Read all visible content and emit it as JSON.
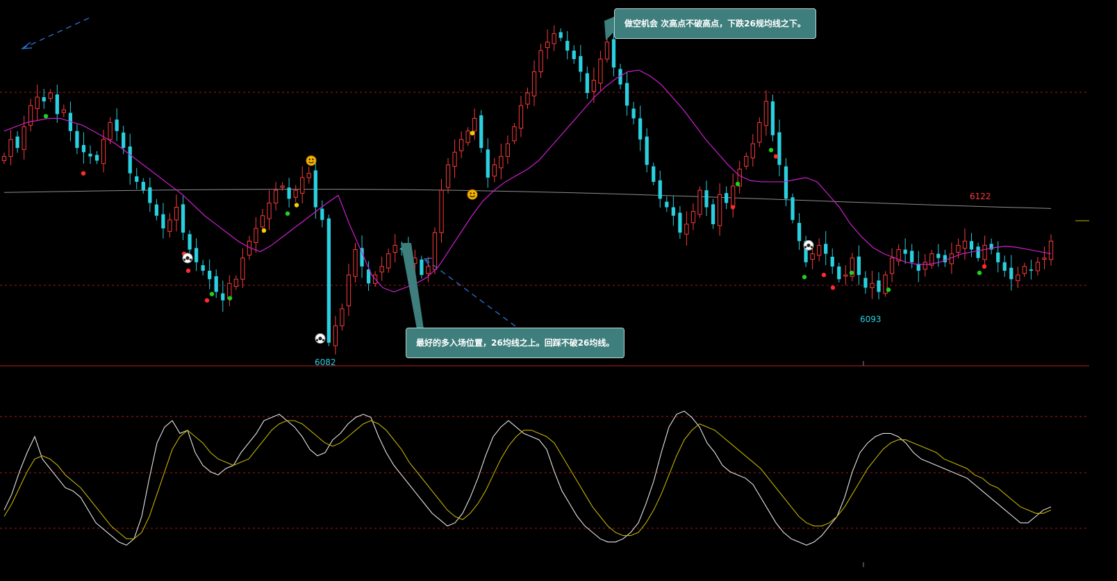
{
  "chart_data": [
    {
      "type": "candlestick",
      "title": "",
      "ma_labels": [],
      "price_labels": [
        {
          "text": "6082",
          "value": 6082,
          "color": "#2ad0e0"
        },
        {
          "text": "6093",
          "value": 6093,
          "color": "#2ad0e0"
        },
        {
          "text": "6122",
          "value": 6122,
          "color": "#ff3b3b"
        }
      ],
      "annotations": [
        {
          "text": "做空机会 次高点不破高点，下跌26规均线之下。"
        },
        {
          "text": "最好的多入场位置，26均线之上。回踩不破26均线。"
        }
      ],
      "ylim": [
        6079,
        6160
      ],
      "close": [
        6126,
        6130,
        6128,
        6133,
        6138,
        6140,
        6139,
        6141,
        6136,
        6137,
        6132,
        6128,
        6127,
        6126,
        6125,
        6130,
        6134,
        6132,
        6128,
        6122,
        6120,
        6118,
        6115,
        6112,
        6109,
        6111,
        6114,
        6108,
        6104,
        6101,
        6099,
        6097,
        6094,
        6092,
        6096,
        6097,
        6102,
        6106,
        6109,
        6112,
        6115,
        6118,
        6119,
        6116,
        6118,
        6121,
        6122,
        6114,
        6111,
        6082,
        6086,
        6090,
        6098,
        6104,
        6100,
        6096,
        6098,
        6100,
        6103,
        6105,
        6104,
        6100,
        6102,
        6098,
        6100,
        6108,
        6118,
        6124,
        6127,
        6130,
        6132,
        6135,
        6128,
        6121,
        6124,
        6126,
        6129,
        6133,
        6138,
        6141,
        6146,
        6151,
        6153,
        6155,
        6154,
        6151,
        6149,
        6146,
        6141,
        6144,
        6149,
        6153,
        6147,
        6143,
        6138,
        6135,
        6130,
        6124,
        6120,
        6116,
        6114,
        6112,
        6108,
        6110,
        6113,
        6118,
        6114,
        6110,
        6117,
        6115,
        6119,
        6123,
        6126,
        6129,
        6134,
        6139,
        6131,
        6124,
        6116,
        6111,
        6106,
        6101,
        6103,
        6105,
        6103,
        6100,
        6097,
        6098,
        6102,
        6098,
        6095,
        6096,
        6094,
        6098,
        6102,
        6104,
        6103,
        6101,
        6099,
        6101,
        6103,
        6102,
        6101,
        6103,
        6105,
        6106,
        6104,
        6102,
        6105,
        6104,
        6101,
        6099,
        6097,
        6098,
        6100,
        6099,
        6101,
        6102,
        6106
      ],
      "ma26": [
        6132,
        6133,
        6134,
        6134.5,
        6135,
        6135,
        6134.2,
        6133.4,
        6132,
        6130.5,
        6129,
        6127,
        6125,
        6123,
        6121,
        6119,
        6117,
        6114.5,
        6112,
        6110,
        6108,
        6106,
        6104.5,
        6103.5,
        6105,
        6107,
        6109,
        6111,
        6113,
        6115,
        6116.8,
        6110,
        6104,
        6098,
        6095,
        6094,
        6095,
        6096,
        6097.5,
        6100,
        6104,
        6108,
        6112,
        6115.5,
        6118,
        6120,
        6121.5,
        6123,
        6125,
        6128,
        6131,
        6134,
        6137,
        6140,
        6142.5,
        6144.5,
        6146,
        6146.4,
        6145,
        6143,
        6140,
        6137,
        6133.5,
        6130,
        6127,
        6124,
        6121.5,
        6120.3,
        6120,
        6120,
        6120,
        6120.5,
        6121,
        6120,
        6117,
        6114,
        6110,
        6107,
        6104.5,
        6103,
        6102,
        6101,
        6100.5,
        6100.5,
        6101,
        6102,
        6103,
        6103.5,
        6104,
        6104.5,
        6104.8,
        6104.5,
        6104,
        6103.5,
        6103
      ]
    },
    {
      "type": "line",
      "title": "",
      "series": [
        {
          "name": "",
          "color": "#e8e8e8",
          "values": [
            12,
            17,
            24,
            30,
            35,
            28,
            25,
            22,
            19,
            18,
            16,
            12,
            8,
            6,
            4,
            2,
            1,
            3,
            10,
            22,
            33,
            38,
            40,
            36,
            37,
            30,
            26,
            24,
            23,
            25,
            26,
            30,
            33,
            36,
            40,
            41,
            42,
            40,
            38,
            35,
            31,
            29,
            30,
            34,
            36,
            39,
            41,
            42,
            41,
            35,
            30,
            26,
            23,
            20,
            17,
            14,
            11,
            9,
            7,
            8,
            11,
            16,
            22,
            29,
            35,
            38,
            40,
            38,
            36,
            35,
            34,
            31,
            24,
            18,
            14,
            10,
            7,
            5,
            3,
            2,
            2,
            3,
            5,
            8,
            14,
            21,
            30,
            38,
            42,
            43,
            41,
            38,
            33,
            30,
            26,
            24,
            23,
            22,
            20,
            16,
            12,
            8,
            5,
            3,
            2,
            1,
            2,
            4,
            7,
            10,
            16,
            24,
            30,
            33,
            35,
            36,
            36,
            35,
            33,
            30,
            28,
            27,
            26,
            25,
            24,
            23,
            22,
            20,
            18,
            16,
            14,
            12,
            10,
            8,
            8,
            10,
            12,
            13
          ]
        },
        {
          "name": "",
          "color": "#c8b400",
          "values": [
            10,
            14,
            19,
            24,
            28,
            29,
            28,
            26,
            23,
            21,
            19,
            16,
            13,
            10,
            7,
            5,
            3,
            3,
            5,
            10,
            17,
            24,
            31,
            35,
            37,
            35,
            33,
            30,
            28,
            27,
            26,
            27,
            28,
            31,
            34,
            37,
            39,
            40,
            40,
            39,
            37,
            35,
            33,
            32,
            33,
            35,
            37,
            39,
            40,
            39,
            37,
            34,
            31,
            27,
            24,
            21,
            18,
            15,
            12,
            10,
            9,
            11,
            14,
            18,
            23,
            28,
            32,
            35,
            37,
            37,
            36,
            35,
            33,
            29,
            25,
            21,
            17,
            13,
            10,
            7,
            5,
            4,
            4,
            5,
            8,
            12,
            17,
            23,
            29,
            34,
            37,
            39,
            38,
            37,
            35,
            33,
            31,
            29,
            27,
            25,
            22,
            19,
            16,
            13,
            10,
            8,
            7,
            7,
            8,
            10,
            13,
            17,
            21,
            25,
            28,
            31,
            33,
            34,
            34,
            33,
            32,
            31,
            30,
            28,
            27,
            26,
            25,
            23,
            22,
            20,
            19,
            17,
            15,
            13,
            12,
            11,
            11,
            12
          ]
        }
      ],
      "ylim": [
        0,
        50
      ]
    }
  ],
  "colors": {
    "up": "#ff3b3b",
    "down": "#2ad0e0",
    "ma": "#d020d0",
    "ma_long": "#8f8f8f"
  }
}
